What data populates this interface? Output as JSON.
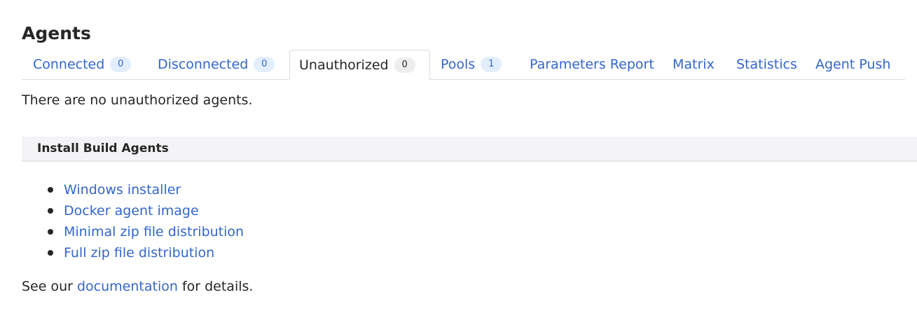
{
  "page": {
    "title": "Agents"
  },
  "tabs": [
    {
      "label": "Connected",
      "count": "0",
      "active": false
    },
    {
      "label": "Disconnected",
      "count": "0",
      "active": false
    },
    {
      "label": "Unauthorized",
      "count": "0",
      "active": true
    },
    {
      "label": "Pools",
      "count": "1",
      "active": false
    },
    {
      "label": "Parameters Report",
      "active": false
    },
    {
      "label": "Matrix",
      "active": false
    },
    {
      "label": "Statistics",
      "active": false
    },
    {
      "label": "Agent Push",
      "active": false
    }
  ],
  "main": {
    "empty_message": "There are no unauthorized agents."
  },
  "install": {
    "title": "Install Build Agents",
    "items": [
      {
        "label": "Windows installer"
      },
      {
        "label": "Docker agent image"
      },
      {
        "label": "Minimal zip file distribution"
      },
      {
        "label": "Full zip file distribution"
      }
    ]
  },
  "footer": {
    "prefix": "See our ",
    "link": "documentation",
    "suffix": " for details."
  },
  "colors": {
    "link": "#3366cc",
    "text": "#262626",
    "section_bg": "#f4f4f6",
    "badge_bg": "#e3eefc"
  }
}
